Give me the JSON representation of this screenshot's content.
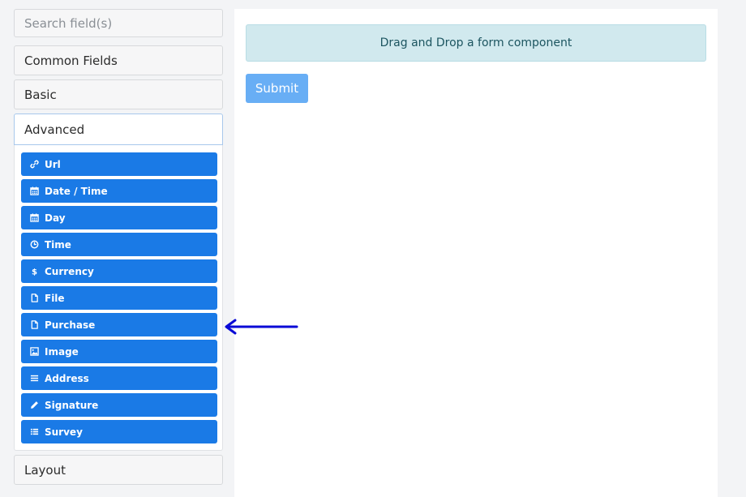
{
  "sidebar": {
    "search_placeholder": "Search field(s)",
    "groups": {
      "common": "Common Fields",
      "basic": "Basic",
      "advanced": "Advanced",
      "layout": "Layout"
    },
    "advanced_items": [
      {
        "label": "Url",
        "icon": "link-icon"
      },
      {
        "label": "Date / Time",
        "icon": "calendar-icon"
      },
      {
        "label": "Day",
        "icon": "calendar-icon"
      },
      {
        "label": "Time",
        "icon": "clock-icon"
      },
      {
        "label": "Currency",
        "icon": "dollar-icon"
      },
      {
        "label": "File",
        "icon": "file-icon"
      },
      {
        "label": "Purchase",
        "icon": "file-icon"
      },
      {
        "label": "Image",
        "icon": "image-icon"
      },
      {
        "label": "Address",
        "icon": "bars-icon"
      },
      {
        "label": "Signature",
        "icon": "pencil-icon"
      },
      {
        "label": "Survey",
        "icon": "list-icon"
      }
    ]
  },
  "builder": {
    "drop_zone_text": "Drag and Drop a form component",
    "submit_label": "Submit"
  },
  "colors": {
    "component_button": "#1a7ae6",
    "submit_button": "#68aef5",
    "drop_zone": "#d1e9ee",
    "annotation_arrow": "#0a0ad6"
  }
}
